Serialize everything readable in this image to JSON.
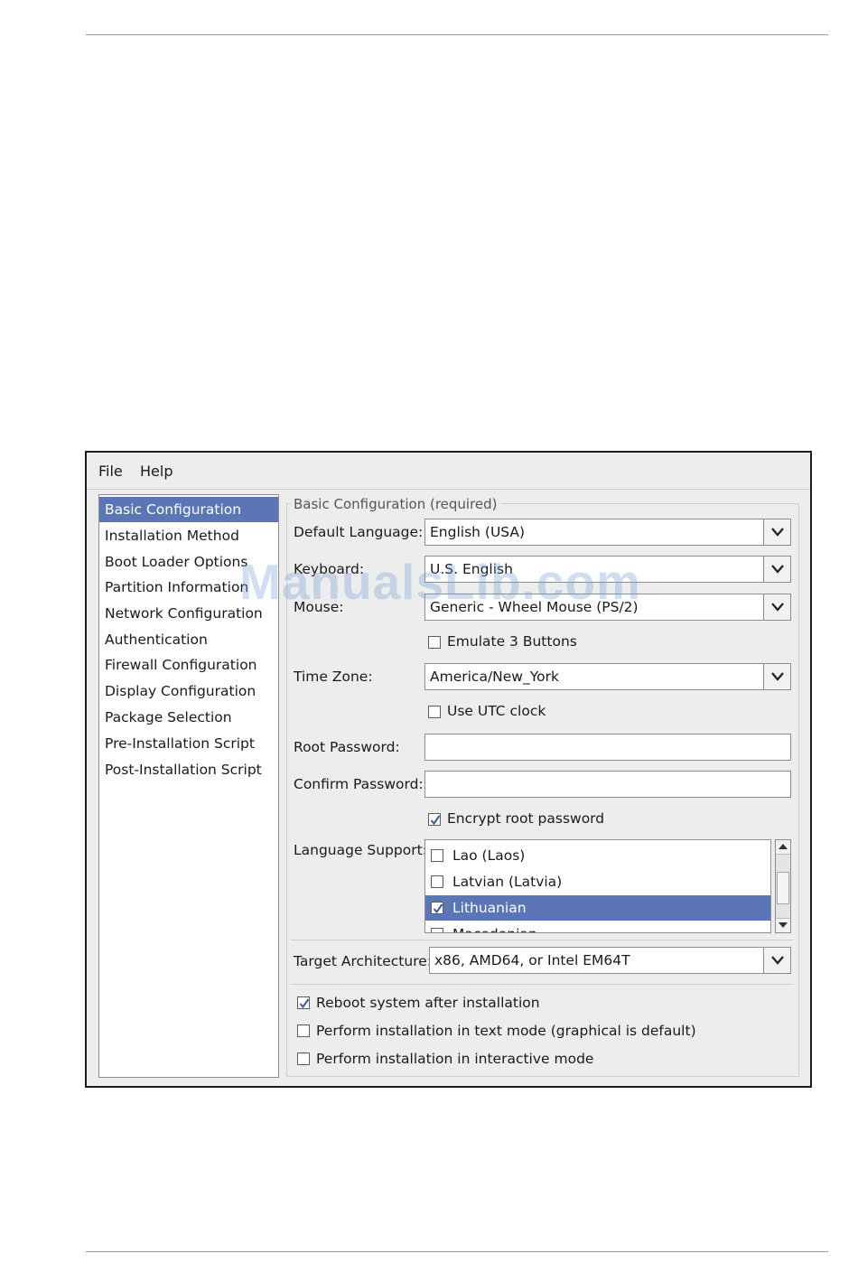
{
  "menu": {
    "file": "File",
    "help": "Help"
  },
  "sidebar": {
    "items": [
      {
        "label": "Basic Configuration",
        "selected": true
      },
      {
        "label": "Installation Method"
      },
      {
        "label": "Boot Loader Options"
      },
      {
        "label": "Partition Information"
      },
      {
        "label": "Network Configuration"
      },
      {
        "label": "Authentication"
      },
      {
        "label": "Firewall Configuration"
      },
      {
        "label": "Display Configuration"
      },
      {
        "label": "Package Selection"
      },
      {
        "label": "Pre-Installation Script"
      },
      {
        "label": "Post-Installation Script"
      }
    ]
  },
  "basic": {
    "section_title": "Basic Configuration (required)",
    "default_language": {
      "label": "Default Language:",
      "value": "English (USA)"
    },
    "keyboard": {
      "label": "Keyboard:",
      "value": "U.S. English"
    },
    "mouse": {
      "label": "Mouse:",
      "value": "Generic - Wheel Mouse (PS/2)"
    },
    "emulate_3_buttons": {
      "label": "Emulate 3 Buttons",
      "checked": false
    },
    "time_zone": {
      "label": "Time Zone:",
      "value": "America/New_York"
    },
    "use_utc_clock": {
      "label": "Use UTC clock",
      "checked": false
    },
    "root_password": {
      "label": "Root Password:",
      "value": ""
    },
    "confirm_password": {
      "label": "Confirm Password:",
      "value": ""
    },
    "encrypt_root_password": {
      "label": "Encrypt root password",
      "checked": true
    },
    "language_support": {
      "label": "Language Support:",
      "items": [
        {
          "label": "Lao (Laos)",
          "checked": false,
          "selected": false
        },
        {
          "label": "Latvian (Latvia)",
          "checked": false,
          "selected": false
        },
        {
          "label": "Lithuanian",
          "checked": true,
          "selected": true
        },
        {
          "label": "Macedonian",
          "checked": false,
          "selected": false
        }
      ]
    },
    "target_architecture": {
      "label": "Target Architecture:",
      "value": "x86, AMD64, or Intel EM64T"
    },
    "options": [
      {
        "label": "Reboot system after installation",
        "checked": true
      },
      {
        "label": "Perform installation in text mode (graphical is default)",
        "checked": false
      },
      {
        "label": "Perform installation in interactive mode",
        "checked": false
      }
    ]
  },
  "watermark": {
    "text": "ManualsLib.com"
  },
  "colors": {
    "selection": "#5a76b7",
    "window_bg": "#ededed"
  },
  "icons": [
    "chevron-down-icon",
    "checkmark-icon",
    "scroll-up-icon",
    "scroll-down-icon"
  ]
}
